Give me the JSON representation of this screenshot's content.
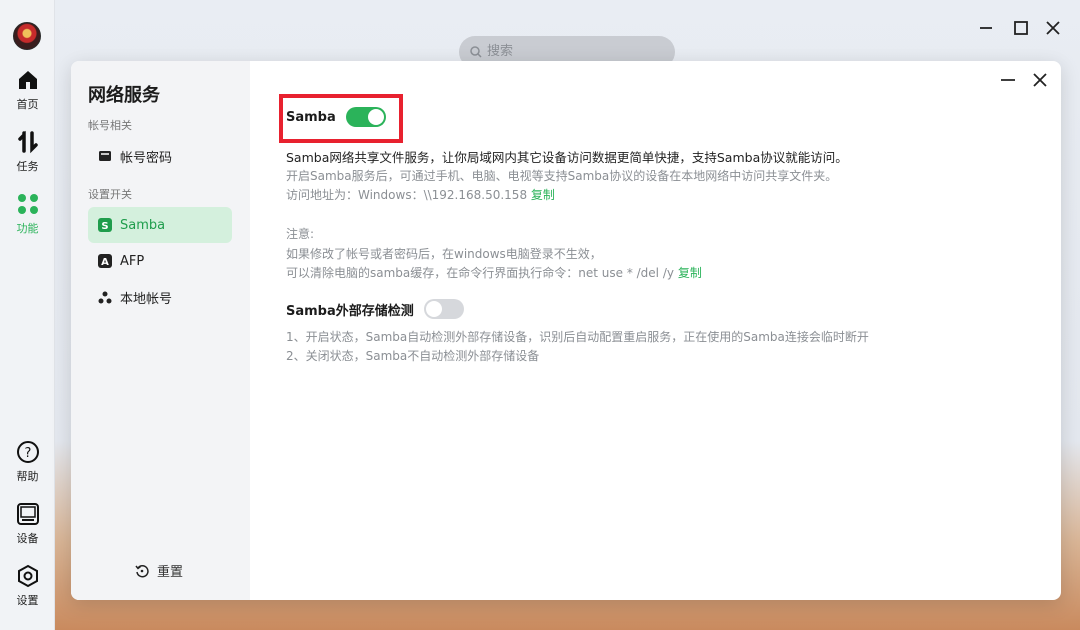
{
  "rail": {
    "items": [
      {
        "label": "首页",
        "icon": "home-icon"
      },
      {
        "label": "任务",
        "icon": "transfer-icon"
      },
      {
        "label": "功能",
        "icon": "apps-icon"
      },
      {
        "label": "帮助",
        "icon": "help-icon"
      },
      {
        "label": "设备",
        "icon": "device-icon"
      },
      {
        "label": "设置",
        "icon": "settings-icon"
      }
    ]
  },
  "search": {
    "placeholder": "搜索"
  },
  "dialog": {
    "title": "网络服务",
    "sections": {
      "account": "帐号相关",
      "switches": "设置开关"
    },
    "menu": {
      "account_password": "帐号密码",
      "samba": "Samba",
      "afp": "AFP",
      "local_account": "本地帐号"
    },
    "reset": "重置"
  },
  "samba": {
    "label": "Samba",
    "enabled": true,
    "desc": "Samba网络共享文件服务，让你局域网内其它设备访问数据更简单快捷，支持Samba协议就能访问。",
    "hint": "开启Samba服务后，可通过手机、电脑、电视等支持Samba协议的设备在本地网络中访问共享文件夹。",
    "address_prefix": "访问地址为：Windows：\\\\192.168.50.158",
    "copy": "复制",
    "note_title": "注意:",
    "note_line1": "如果修改了帐号或者密码后，在windows电脑登录不生效，",
    "note_line2": "可以清除电脑的samba缓存，在命令行界面执行命令：net use * /del /y",
    "copy2": "复制"
  },
  "external": {
    "label": "Samba外部存储检测",
    "enabled": false,
    "line1": "1、开启状态，Samba自动检测外部存储设备，识别后自动配置重启服务，正在使用的Samba连接会临时断开",
    "line2": "2、关闭状态，Samba不自动检测外部存储设备"
  },
  "colors": {
    "accent": "#2bb35a",
    "highlight": "#e8212f"
  }
}
